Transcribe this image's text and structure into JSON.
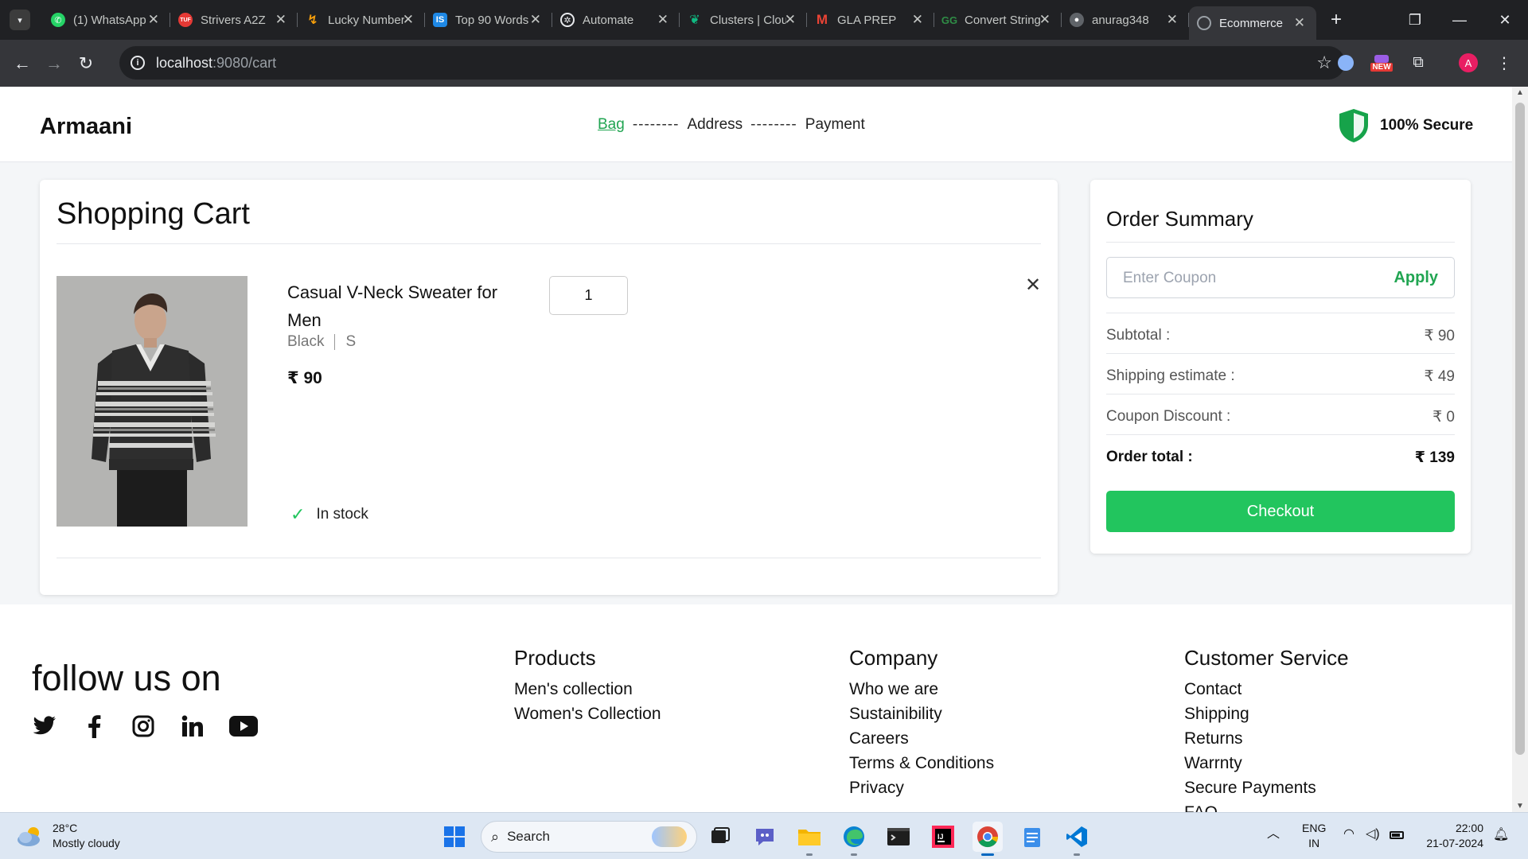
{
  "browser": {
    "tabs": [
      {
        "title": "(1) WhatsApp",
        "icon": "whatsapp-icon",
        "color": "#25d366"
      },
      {
        "title": "Strivers A2Z",
        "icon": "tuf-icon",
        "color": "#e53935"
      },
      {
        "title": "Lucky Numbers",
        "icon": "lightning-icon",
        "color": "#f59e0b"
      },
      {
        "title": "Top 90 Words",
        "icon": "is-icon",
        "color": "#1e88e5"
      },
      {
        "title": "Automate",
        "icon": "openai-icon",
        "color": "#ffffff"
      },
      {
        "title": "Clusters | Cloud",
        "icon": "mongodb-icon",
        "color": "#10b981"
      },
      {
        "title": "GLA PREP",
        "icon": "gmail-icon",
        "color": "#ea4335"
      },
      {
        "title": "Convert String",
        "icon": "gfg-icon",
        "color": "#2f8d46"
      },
      {
        "title": "anurag348",
        "icon": "github-icon",
        "color": "#9aa0a6"
      },
      {
        "title": "Ecommerce",
        "icon": "globe-icon",
        "color": "#9aa0a6",
        "active": true
      }
    ],
    "url_host": "localhost",
    "url_path": ":9080/cart",
    "extension_badge": "NEW",
    "profile_initial": "A"
  },
  "site": {
    "brand": "Armaani",
    "steps": [
      "Bag",
      "--------",
      "Address",
      "--------",
      "Payment"
    ],
    "secure_label": "100% Secure"
  },
  "cart": {
    "title": "Shopping Cart",
    "item": {
      "name": "Casual V-Neck Sweater for Men",
      "color": "Black",
      "size": "S",
      "price": "₹ 90",
      "quantity": "1",
      "stock": "In stock"
    }
  },
  "summary": {
    "title": "Order Summary",
    "coupon_placeholder": "Enter Coupon",
    "apply_label": "Apply",
    "rows": [
      {
        "label": "Subtotal :",
        "value": "₹ 90"
      },
      {
        "label": "Shipping estimate :",
        "value": "₹ 49"
      },
      {
        "label": "Coupon Discount :",
        "value": "₹ 0"
      },
      {
        "label": "Order total :",
        "value": "₹ 139"
      }
    ],
    "checkout_label": "Checkout"
  },
  "footer": {
    "follow": "follow us on",
    "socials": [
      "twitter-icon",
      "facebook-icon",
      "instagram-icon",
      "linkedin-icon",
      "youtube-icon"
    ],
    "columns": [
      {
        "title": "Products",
        "items": [
          "Men's collection",
          "Women's Collection"
        ]
      },
      {
        "title": "Company",
        "items": [
          "Who we are",
          "Sustainibility",
          "Careers",
          "Terms & Conditions",
          "Privacy"
        ]
      },
      {
        "title": "Customer Service",
        "items": [
          "Contact",
          "Shipping",
          "Returns",
          "Warrnty",
          "Secure Payments",
          "FAQ"
        ]
      }
    ]
  },
  "taskbar": {
    "temperature": "28°C",
    "weather": "Mostly cloudy",
    "search_label": "Search",
    "language": "ENG",
    "region": "IN",
    "time": "22:00",
    "date": "21-07-2024"
  },
  "colors": {
    "accent": "#22c55e",
    "accent_text": "#21a552",
    "shield": "#16a34a"
  }
}
